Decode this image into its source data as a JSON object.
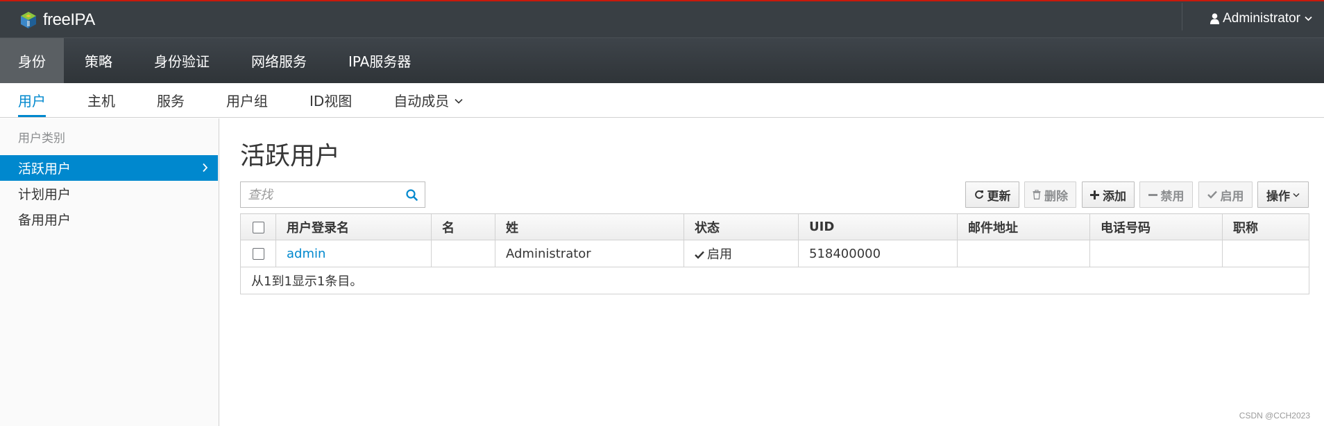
{
  "app": {
    "brand_name": "freeIPA",
    "brand_accent": "#0088ce"
  },
  "masthead": {
    "user_label": "Administrator"
  },
  "nav_primary": [
    {
      "label": "身份",
      "active": true
    },
    {
      "label": "策略"
    },
    {
      "label": "身份验证"
    },
    {
      "label": "网络服务"
    },
    {
      "label": "IPA服务器"
    }
  ],
  "nav_secondary": [
    {
      "label": "用户",
      "active": true
    },
    {
      "label": "主机"
    },
    {
      "label": "服务"
    },
    {
      "label": "用户组"
    },
    {
      "label": "ID视图"
    },
    {
      "label": "自动成员",
      "has_dropdown": true
    }
  ],
  "sidebar": {
    "heading": "用户类别",
    "items": [
      {
        "label": "活跃用户",
        "active": true
      },
      {
        "label": "计划用户"
      },
      {
        "label": "备用用户"
      }
    ]
  },
  "main": {
    "title": "活跃用户",
    "search_placeholder": "查找",
    "buttons": {
      "refresh": "更新",
      "delete": "删除",
      "add": "添加",
      "disable": "禁用",
      "enable": "启用",
      "actions": "操作"
    },
    "table": {
      "headers": [
        "用户登录名",
        "名",
        "姓",
        "状态",
        "UID",
        "邮件地址",
        "电话号码",
        "职称"
      ],
      "rows": [
        {
          "login": "admin",
          "first_name": "",
          "last_name": "Administrator",
          "status": "启用",
          "uid": "518400000",
          "email": "",
          "phone": "",
          "title": ""
        }
      ],
      "footer": "从1到1显示1条目。"
    }
  },
  "watermark": "CSDN @CCH2023"
}
